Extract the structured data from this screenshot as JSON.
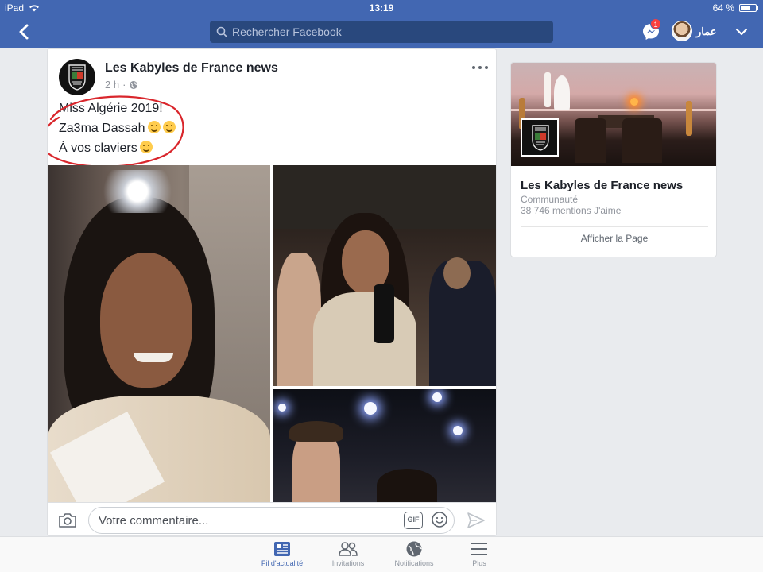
{
  "status_bar": {
    "device": "iPad",
    "time": "13:19",
    "battery": "64 %",
    "battery_level": 0.64
  },
  "nav": {
    "search_placeholder": "Rechercher Facebook",
    "messenger_badge": "1",
    "username": "عمار"
  },
  "post": {
    "page_name": "Les Kabyles de France news",
    "time": "2 h",
    "privacy_icon": "globe-icon",
    "lines": [
      "Miss Algérie 2019!",
      "Za3ma Dassah",
      "À vos claviers"
    ],
    "emojis": [
      "rofl-emoji",
      "joy-emoji",
      "thinking-emoji"
    ],
    "annotation_color": "#d9262c"
  },
  "comment_bar": {
    "placeholder": "Votre commentaire...",
    "gif_label": "GIF"
  },
  "page_card": {
    "name": "Les Kabyles de France news",
    "category": "Communauté",
    "likes": "38 746 mentions J'aime",
    "button": "Afficher la Page"
  },
  "tabs": [
    {
      "label": "Fil d'actualité",
      "icon": "news-feed-icon",
      "active": true
    },
    {
      "label": "Invitations",
      "icon": "friends-icon",
      "active": false
    },
    {
      "label": "Notifications",
      "icon": "globe-icon",
      "active": false
    },
    {
      "label": "Plus",
      "icon": "menu-icon",
      "active": false
    }
  ],
  "colors": {
    "brand": "#4267b2",
    "background": "#e9ebee"
  }
}
